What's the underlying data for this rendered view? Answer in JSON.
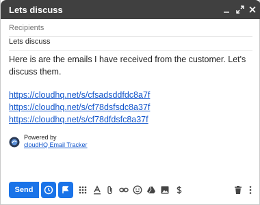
{
  "window": {
    "title": "Lets discuss"
  },
  "fields": {
    "recipients_placeholder": "Recipients",
    "subject": "Lets discuss"
  },
  "body": {
    "text": "Here is are the emails I have received from the customer. Let's discuss them.",
    "links": [
      "https://cloudhq.net/s/cfsadsddfdc8a7f",
      "https://cloudhq.net/s/cf78dsfsdc8a37f",
      "https://cloudhq.net/s/cf78dfdsfc8a37f"
    ]
  },
  "tracker": {
    "powered_by": "Powered by",
    "name": "cloudHQ Email Tracker"
  },
  "toolbar": {
    "send_label": "Send"
  },
  "colors": {
    "titlebar": "#404040",
    "accent": "#1a73e8",
    "link": "#1155cc"
  },
  "icons": [
    "minimize-icon",
    "expand-icon",
    "close-icon",
    "schedule-icon",
    "tracker-icon",
    "dots-grid-icon",
    "text-format-icon",
    "attach-icon",
    "link-icon",
    "emoji-icon",
    "drive-icon",
    "photo-icon",
    "dollar-icon",
    "trash-icon",
    "more-options-icon"
  ]
}
